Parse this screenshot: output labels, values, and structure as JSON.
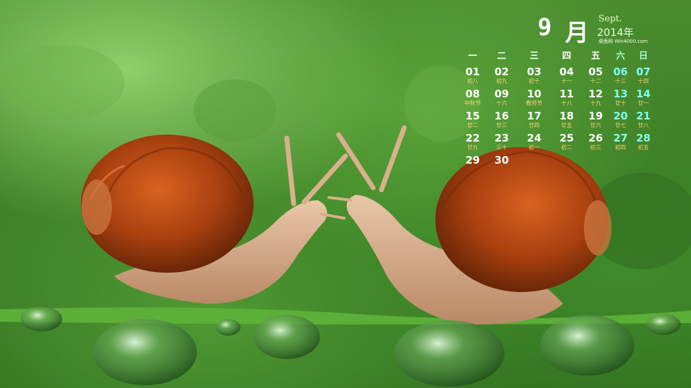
{
  "calendar": {
    "month_number": "9",
    "month_cn": "月",
    "month_en": "Sept.",
    "year": "2014年",
    "site": "桌面网  Win4000.com",
    "weekdays": [
      "一",
      "二",
      "三",
      "四",
      "五",
      "六",
      "日"
    ],
    "days": [
      {
        "d": "01",
        "l": "初八"
      },
      {
        "d": "02",
        "l": "初九"
      },
      {
        "d": "03",
        "l": "初十"
      },
      {
        "d": "04",
        "l": "十一"
      },
      {
        "d": "05",
        "l": "十二"
      },
      {
        "d": "06",
        "l": "十三"
      },
      {
        "d": "07",
        "l": "十四"
      },
      {
        "d": "08",
        "l": "中秋节"
      },
      {
        "d": "09",
        "l": "十六"
      },
      {
        "d": "10",
        "l": "教师节"
      },
      {
        "d": "11",
        "l": "十八"
      },
      {
        "d": "12",
        "l": "十九"
      },
      {
        "d": "13",
        "l": "廿十"
      },
      {
        "d": "14",
        "l": "廿一"
      },
      {
        "d": "15",
        "l": "廿二"
      },
      {
        "d": "16",
        "l": "廿三"
      },
      {
        "d": "17",
        "l": "廿四"
      },
      {
        "d": "18",
        "l": "廿五"
      },
      {
        "d": "19",
        "l": "廿六"
      },
      {
        "d": "20",
        "l": "廿七"
      },
      {
        "d": "21",
        "l": "廿八"
      },
      {
        "d": "22",
        "l": "廿九"
      },
      {
        "d": "23",
        "l": "三十"
      },
      {
        "d": "24",
        "l": "初一"
      },
      {
        "d": "25",
        "l": "初二"
      },
      {
        "d": "26",
        "l": "初三"
      },
      {
        "d": "27",
        "l": "初四"
      },
      {
        "d": "28",
        "l": "初五"
      },
      {
        "d": "29",
        "l": ""
      },
      {
        "d": "30",
        "l": ""
      }
    ]
  },
  "colors": {
    "weekday_text": "#ffffff",
    "weekend_text": "#7ffff0",
    "lunar_text": "#ffcf7a",
    "background": "#3d7d25",
    "shell": "#b24a16"
  }
}
